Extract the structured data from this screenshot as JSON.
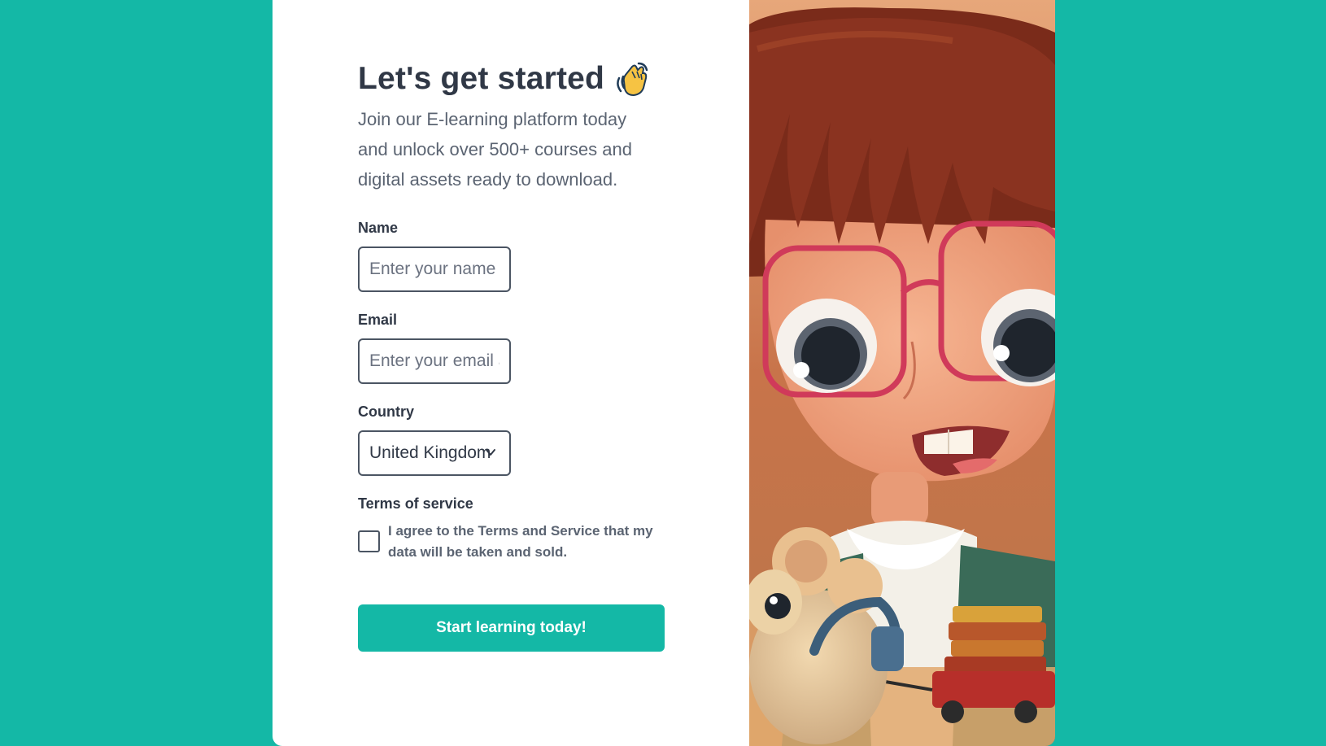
{
  "hero": {
    "title": "Let's get started",
    "wave_icon": "waving-hand-icon",
    "subtitle": "Join our E-learning platform today and unlock over 500+ courses and digital assets ready to download."
  },
  "form": {
    "name_label": "Name",
    "name_placeholder": "Enter your name",
    "email_label": "Email",
    "email_placeholder": "Enter your email address",
    "country_label": "Country",
    "country_value": "United Kingdom",
    "terms_label": "Terms of service",
    "terms_text": "I agree to the Terms and Service that my data will be taken and sold.",
    "terms_checked": false,
    "submit_label": "Start learning today!"
  },
  "colors": {
    "accent": "#14b8a6",
    "heading": "#303846",
    "body_text": "#5b6472",
    "border": "#4b5563"
  },
  "illustration": {
    "icon": "girl-with-glasses-and-mouse-illustration"
  }
}
